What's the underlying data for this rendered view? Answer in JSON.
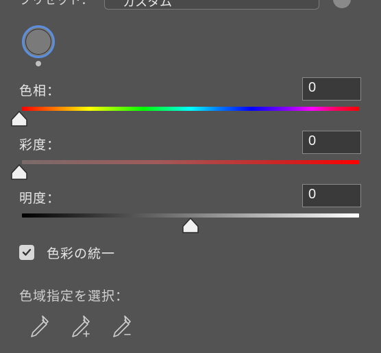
{
  "preset": {
    "label": "プリセット：",
    "value": "カスタム"
  },
  "sliders": {
    "hue": {
      "label": "色相：",
      "value": "0",
      "position": 0
    },
    "saturation": {
      "label": "彩度：",
      "value": "0",
      "position": 0
    },
    "lightness": {
      "label": "明度：",
      "value": "0",
      "position": 0.5
    }
  },
  "colorize": {
    "label": "色彩の統一",
    "checked": true
  },
  "color_range": {
    "label": "色域指定を選択："
  },
  "eyedroppers": [
    {
      "icon": "eyedropper-icon"
    },
    {
      "icon": "eyedropper-add-icon"
    },
    {
      "icon": "eyedropper-subtract-icon"
    }
  ],
  "colors": {
    "panel_bg": "#535353",
    "accent": "#5a8fe0",
    "target_color": "#7a7a7a"
  }
}
